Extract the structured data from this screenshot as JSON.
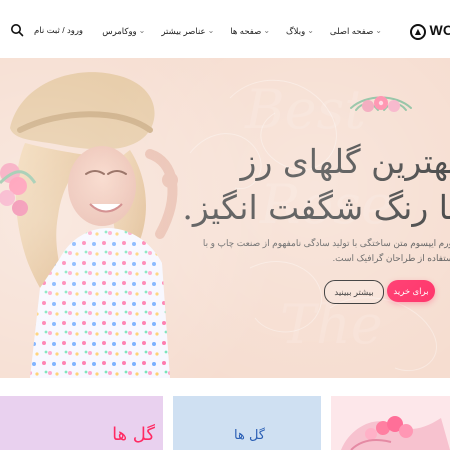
{
  "header": {
    "logo_text": "WO",
    "logo_icon": "tree-icon",
    "nav": {
      "home": "صفحه اصلی",
      "blog": "وبلاگ",
      "pages": "صفحه ها",
      "more_elements": "عناصر بیشتر",
      "woocommerce": "ووکامرس"
    },
    "login_label": "ورود / ثبت نام",
    "search_icon": "search-icon",
    "chevron_icon": "chevron-down-icon"
  },
  "hero": {
    "title_line1": "بهترین گلهای رز",
    "title_line2": "با رنگ شگفت انگیز.",
    "description": "لورم ایپسوم متن ساختگی با تولید سادگی نامفهوم از صنعت چاپ و با استفاده از طراحان گرافیک است.",
    "buttons": {
      "buy": "برای خرید",
      "more": "بیشتر ببینید"
    }
  },
  "cards": [
    {
      "title": "گل ها"
    },
    {
      "title": "گل ها"
    },
    {
      "title": ""
    }
  ],
  "colors": {
    "accent_pink": "#ff2a63",
    "hero_bg": "#f6ddd0",
    "card1_bg": "#e9d1ef",
    "card2_bg": "#cfe0f2",
    "card3_bg": "#fde7ea"
  }
}
